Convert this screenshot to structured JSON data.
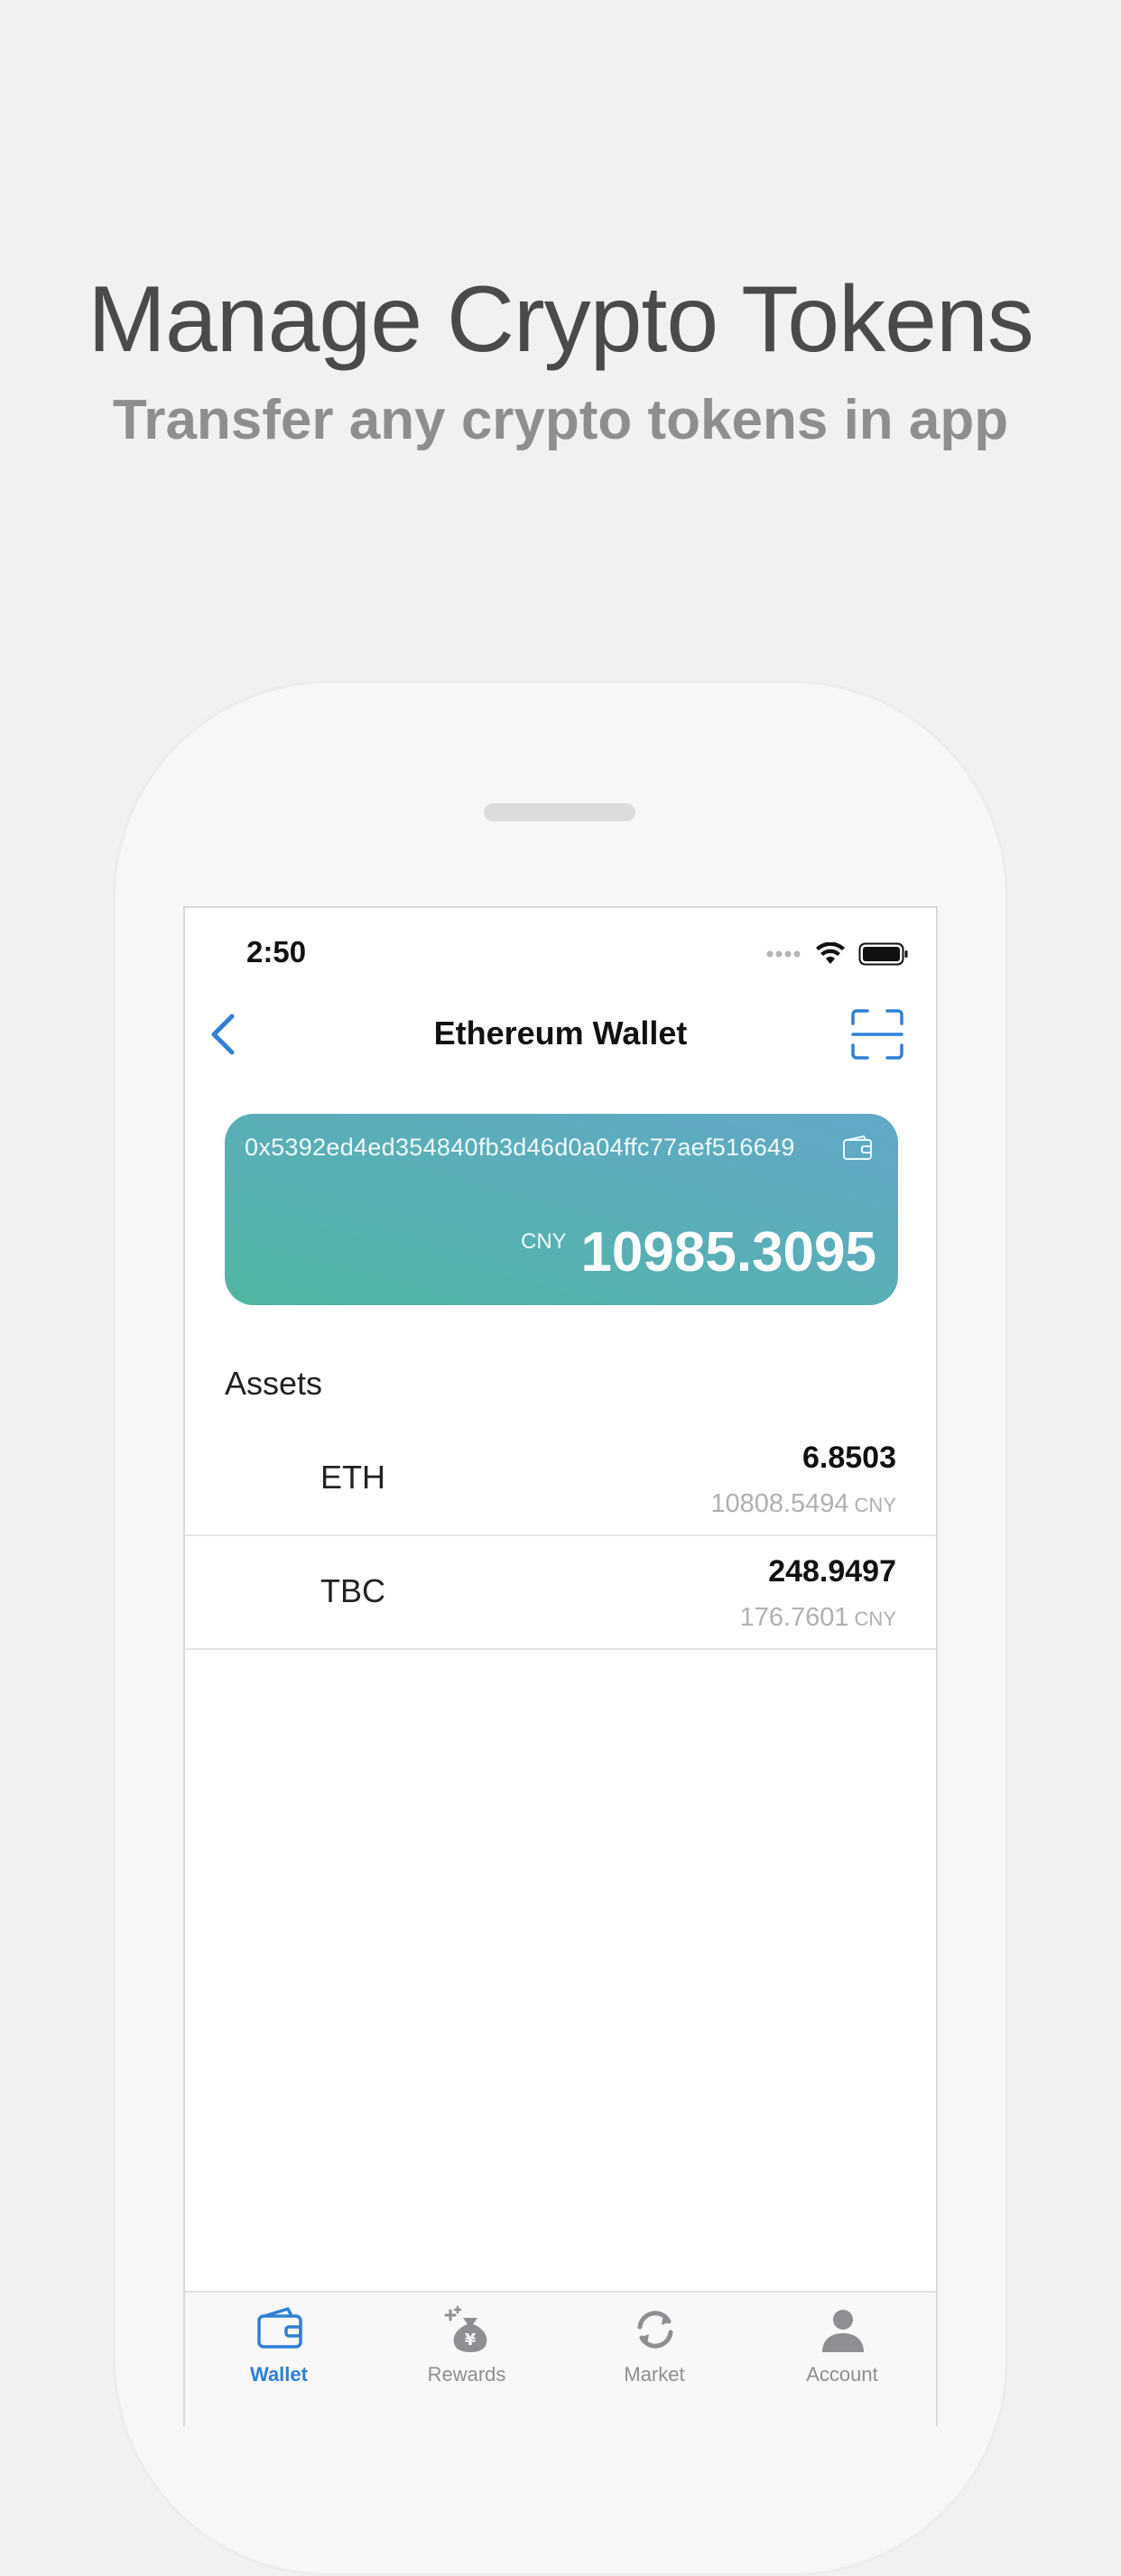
{
  "promo": {
    "headline": "Manage Crypto Tokens",
    "subheadline": "Transfer any crypto tokens in app"
  },
  "status_bar": {
    "time": "2:50",
    "icons": [
      "signal-dots-icon",
      "wifi-icon",
      "battery-icon"
    ]
  },
  "nav": {
    "title": "Ethereum Wallet",
    "back_icon": "chevron-left-icon",
    "scan_icon": "scan-icon"
  },
  "wallet_card": {
    "address": "0x5392ed4ed354840fb3d46d0a04ffc77aef516649",
    "copy_icon": "wallet-copy-icon",
    "currency": "CNY",
    "balance": "10985.3095"
  },
  "assets": {
    "title": "Assets",
    "items": [
      {
        "symbol": "ETH",
        "amount": "6.8503",
        "value": "10808.5494",
        "unit": "CNY"
      },
      {
        "symbol": "TBC",
        "amount": "248.9497",
        "value": "176.7601",
        "unit": "CNY"
      }
    ]
  },
  "tabbar": {
    "items": [
      {
        "label": "Wallet",
        "icon": "wallet-icon",
        "active": true
      },
      {
        "label": "Rewards",
        "icon": "money-bag-icon",
        "active": false
      },
      {
        "label": "Market",
        "icon": "refresh-icon",
        "active": false
      },
      {
        "label": "Account",
        "icon": "person-icon",
        "active": false
      }
    ]
  },
  "colors": {
    "accent": "#2f7fd6",
    "card_gradient_start": "#4fb6a2",
    "card_gradient_end": "#62a8c8",
    "muted_text": "#b0b0b0"
  }
}
